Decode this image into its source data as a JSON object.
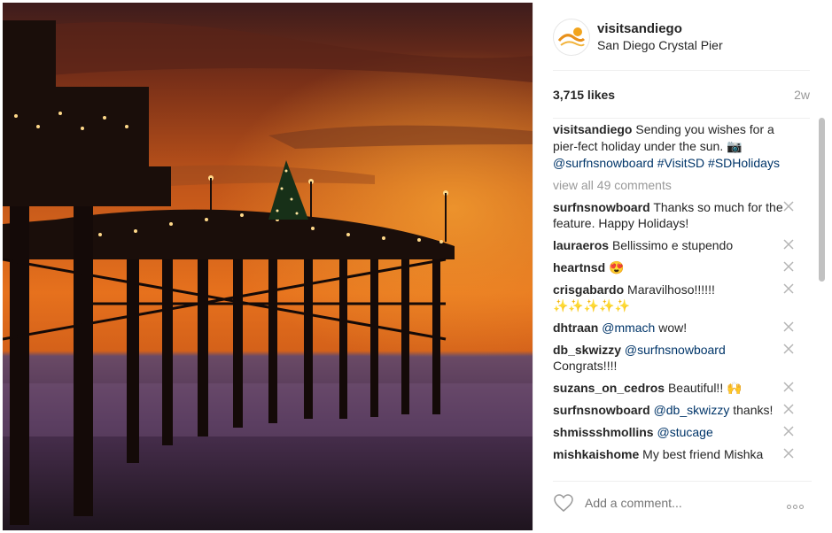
{
  "post": {
    "username": "visitsandiego",
    "location": "San Diego Crystal Pier",
    "likes": "3,715 likes",
    "age": "2w"
  },
  "caption": {
    "username": "visitsandiego",
    "text": "Sending you wishes for a pier-fect holiday under the sun. 📷",
    "mention": "@surfnsnowboard",
    "hashtags": "#VisitSD #SDHolidays"
  },
  "view_all": "view all 49 comments",
  "comments": [
    {
      "user": "surfnsnowboard",
      "text": "Thanks so much for the feature. Happy Holidays!",
      "mention": ""
    },
    {
      "user": "lauraeros",
      "text": "Bellissimo e stupendo",
      "mention": ""
    },
    {
      "user": "heartnsd",
      "text": "😍",
      "mention": ""
    },
    {
      "user": "crisgabardo",
      "text": "Maravilhoso!!!!!! ✨✨✨✨✨",
      "mention": ""
    },
    {
      "user": "dhtraan",
      "text": "wow!",
      "mention": "@mmach"
    },
    {
      "user": "db_skwizzy",
      "text": "Congrats!!!!",
      "mention": "@surfnsnowboard"
    },
    {
      "user": "suzans_on_cedros",
      "text": "Beautiful!! 🙌",
      "mention": ""
    },
    {
      "user": "surfnsnowboard",
      "text": "thanks!",
      "mention": "@db_skwizzy"
    },
    {
      "user": "shmissshmollins",
      "text": "",
      "mention": "@stucage"
    },
    {
      "user": "mishkaishome",
      "text": "My best friend Mishka",
      "mention": ""
    }
  ],
  "footer": {
    "placeholder": "Add a comment..."
  },
  "icons": {
    "heart": "heart-icon",
    "remove": "close-icon",
    "more": "more-options-icon"
  }
}
